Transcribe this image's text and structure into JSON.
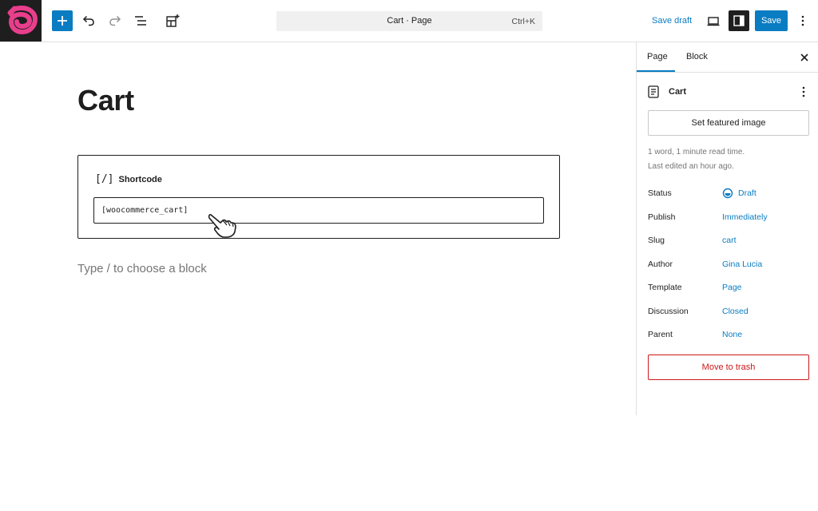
{
  "toolbar": {
    "command_title": "Cart · Page",
    "command_shortcut": "Ctrl+K",
    "save_draft_label": "Save draft",
    "save_label": "Save",
    "logo_color": "#e83e8c",
    "accent_color": "#0a7cc2"
  },
  "editor": {
    "page_title": "Cart",
    "shortcode_block": {
      "icon": "[/]",
      "label": "Shortcode",
      "value": "[woocommerce_cart]"
    },
    "block_placeholder": "Type / to choose a block"
  },
  "sidebar": {
    "tabs": [
      {
        "label": "Page",
        "active": true
      },
      {
        "label": "Block",
        "active": false
      }
    ],
    "document": {
      "title": "Cart",
      "featured_image_button": "Set featured image",
      "read_time": "1 word, 1 minute read time.",
      "last_edited": "Last edited an hour ago."
    },
    "properties": [
      {
        "label": "Status",
        "value": "Draft"
      },
      {
        "label": "Publish",
        "value": "Immediately"
      },
      {
        "label": "Slug",
        "value": "cart"
      },
      {
        "label": "Author",
        "value": "Gina Lucia"
      },
      {
        "label": "Template",
        "value": "Page"
      },
      {
        "label": "Discussion",
        "value": "Closed"
      },
      {
        "label": "Parent",
        "value": "None"
      }
    ],
    "trash_label": "Move to trash"
  }
}
